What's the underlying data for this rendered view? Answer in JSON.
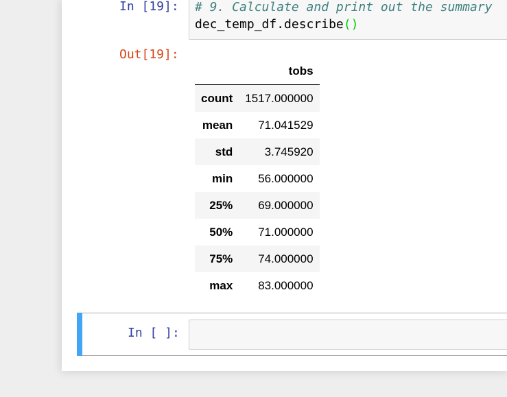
{
  "cells": {
    "code_cell": {
      "in_prompt": "In [19]:",
      "code_line_1": "# 9. Calculate and print out the summary",
      "code_line_2_prefix": "dec_temp_df.describe",
      "code_line_2_paren": "()"
    },
    "output": {
      "out_prompt": "Out[19]:",
      "table": {
        "column_header": "tobs",
        "rows": [
          {
            "label": "count",
            "value": "1517.000000"
          },
          {
            "label": "mean",
            "value": "71.041529"
          },
          {
            "label": "std",
            "value": "3.745920"
          },
          {
            "label": "min",
            "value": "56.000000"
          },
          {
            "label": "25%",
            "value": "69.000000"
          },
          {
            "label": "50%",
            "value": "71.000000"
          },
          {
            "label": "75%",
            "value": "74.000000"
          },
          {
            "label": "max",
            "value": "83.000000"
          }
        ]
      }
    },
    "empty_cell": {
      "in_prompt": "In [ ]:"
    }
  },
  "colors": {
    "in_prompt": "#303f9f",
    "out_prompt": "#d84315",
    "selected_cell_bar": "#42a5f5"
  }
}
